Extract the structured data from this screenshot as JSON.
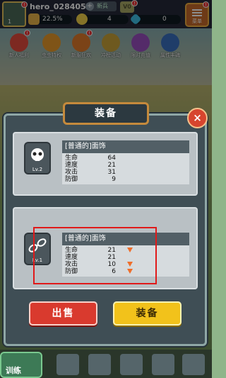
{
  "player": {
    "name": "hero_028405",
    "level": "1",
    "exp_percent": "22.5%",
    "exp_fraction": 0.225,
    "rank_label": "新兵",
    "vip_label": "V0",
    "gold": "4",
    "gems": "0"
  },
  "menu": {
    "label": "菜单"
  },
  "activities": [
    {
      "label": "新人福利",
      "color": "#e34c3c"
    },
    {
      "label": "虫虫特权",
      "color": "#e89a2a"
    },
    {
      "label": "新服狂欢",
      "color": "#e07a2a"
    },
    {
      "label": "冲榜活动",
      "color": "#c9a23a"
    },
    {
      "label": "限时充值",
      "color": "#9a4fc0"
    },
    {
      "label": "属性丰碑",
      "color": "#3a6fc0"
    }
  ],
  "dialog": {
    "title": "装备",
    "close_label": "×",
    "current": {
      "name": "[普通的]面饰",
      "level": "Lv.2",
      "stats": [
        {
          "label": "生命",
          "value": "64"
        },
        {
          "label": "速度",
          "value": "21"
        },
        {
          "label": "攻击",
          "value": "31"
        },
        {
          "label": "防御",
          "value": "9"
        }
      ]
    },
    "candidate": {
      "name": "[普通的]面饰",
      "level": "Lv.1",
      "stats": [
        {
          "label": "生命",
          "value": "21",
          "down": true
        },
        {
          "label": "速度",
          "value": "21",
          "down": false
        },
        {
          "label": "攻击",
          "value": "10",
          "down": true
        },
        {
          "label": "防御",
          "value": "6",
          "down": true
        }
      ]
    },
    "sell_label": "出售",
    "equip_label": "装备"
  },
  "bottom": {
    "train_label": "训练"
  }
}
